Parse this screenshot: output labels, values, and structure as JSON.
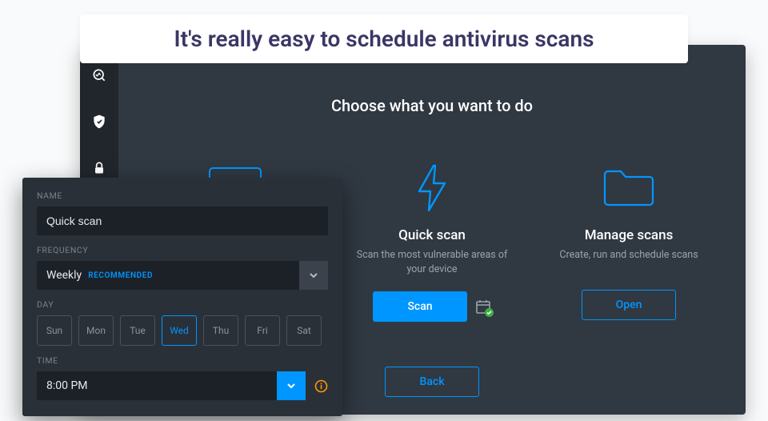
{
  "headline": "It's really easy to schedule antivirus scans",
  "main": {
    "title": "Choose what you want to do",
    "back_label": "Back",
    "cards": [
      {
        "name": "Quick scan",
        "desc": "Scan the most vulnerable areas of your device",
        "action": "Scan"
      },
      {
        "name": "Manage scans",
        "desc": "Create, run and schedule scans",
        "action": "Open"
      }
    ]
  },
  "schedule": {
    "labels": {
      "name": "NAME",
      "frequency": "FREQUENCY",
      "day": "DAY",
      "time": "TIME"
    },
    "name_value": "Quick scan",
    "frequency_value": "Weekly",
    "frequency_tag": "RECOMMENDED",
    "days": [
      "Sun",
      "Mon",
      "Tue",
      "Wed",
      "Thu",
      "Fri",
      "Sat"
    ],
    "selected_day_index": 3,
    "time_value": "8:00 PM"
  }
}
